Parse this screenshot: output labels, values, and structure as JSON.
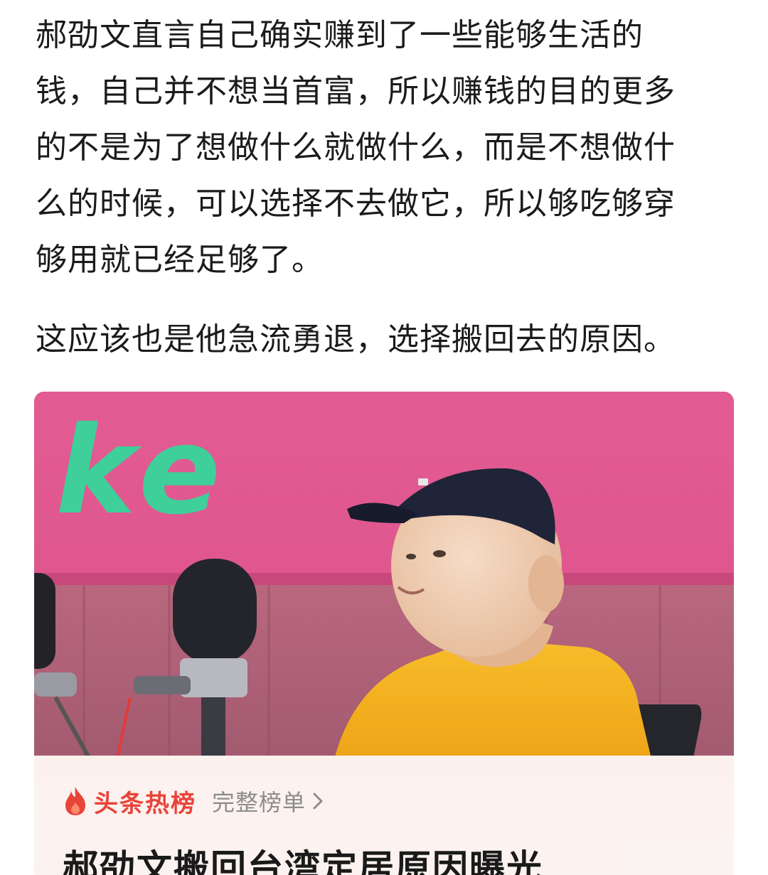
{
  "article": {
    "paragraph1": [
      "郝劭文直言自己确实赚到了一些能够生活的",
      "钱，自己并不想当首富，所以赚钱的目的更多",
      "的不是为了想做什么就做什么，而是不想做什",
      "么的时候，可以选择不去做它，所以够吃够穿",
      "够用就已经足够了。"
    ],
    "paragraph2": "这应该也是他急流勇退，选择搬回去的原因。"
  },
  "image": {
    "sign_text": "ke",
    "hot_list": {
      "icon": "flame-icon",
      "title": "头条热榜",
      "link_label": "完整榜单",
      "link_icon": "chevron-right-icon",
      "headline": "郝劭文搬回台湾定居原因曝光"
    }
  },
  "colors": {
    "text": "#1b1b1b",
    "hot_red": "#e8443a",
    "link_gray": "#8c8c8c",
    "wall_pink": "#d9558a",
    "shirt_yellow": "#f2b21d",
    "sign_green": "#3ecf9a"
  }
}
